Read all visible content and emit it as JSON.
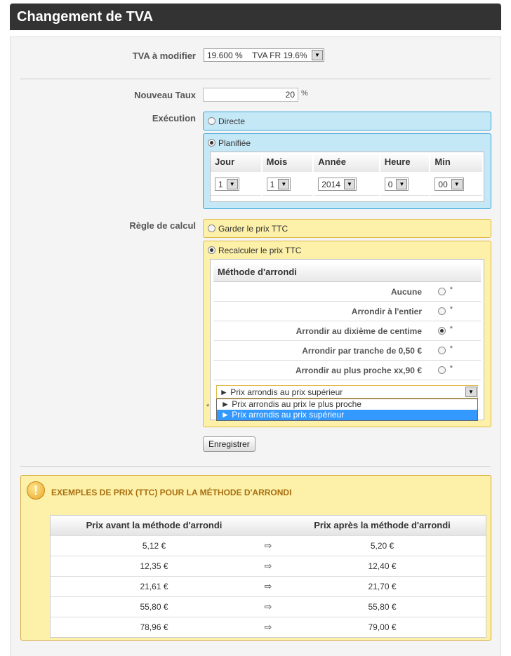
{
  "header": {
    "title": "Changement de TVA"
  },
  "tva": {
    "label": "TVA à modifier",
    "selected_rate": "19.600 %",
    "selected_name": "TVA FR 19.6%"
  },
  "nouveau_taux": {
    "label": "Nouveau Taux",
    "value": "20",
    "unit": "%"
  },
  "execution": {
    "label": "Exécution",
    "directe": "Directe",
    "planifiee": "Planifiée",
    "columns": [
      "Jour",
      "Mois",
      "Année",
      "Heure",
      "Min"
    ],
    "values": [
      "1",
      "1",
      "2014",
      "0",
      "00"
    ]
  },
  "regle": {
    "label": "Règle de calcul",
    "garder": "Garder le prix TTC",
    "recalculer": "Recalculer le prix TTC",
    "methode_title": "Méthode d'arrondi",
    "methods": [
      {
        "label": "Aucune",
        "selected": false
      },
      {
        "label": "Arrondir à l'entier",
        "selected": false
      },
      {
        "label": "Arrondir au dixième de centime",
        "selected": true
      },
      {
        "label": "Arrondir par tranche de 0,50 €",
        "selected": false
      },
      {
        "label": "Arrondir au plus proche xx,90 €",
        "selected": false
      }
    ],
    "asterisk": "*",
    "dropdown_selected": "► Prix arrondis au prix supérieur",
    "dropdown_options": [
      "► Prix arrondis au prix le plus proche",
      "► Prix arrondis au prix supérieur"
    ]
  },
  "save_button": "Enregistrer",
  "examples": {
    "title": "EXEMPLES DE PRIX (TTC) POUR LA MÉTHODE D'ARRONDI",
    "col_before": "Prix avant la méthode d'arrondi",
    "col_after": "Prix après la méthode d'arrondi",
    "rows": [
      {
        "before": "5,12 €",
        "after": "5,20 €"
      },
      {
        "before": "12,35 €",
        "after": "12,40 €"
      },
      {
        "before": "21,61 €",
        "after": "21,70 €"
      },
      {
        "before": "55,80 €",
        "after": "55,80 €"
      },
      {
        "before": "78,96 €",
        "after": "79,00 €"
      }
    ]
  }
}
